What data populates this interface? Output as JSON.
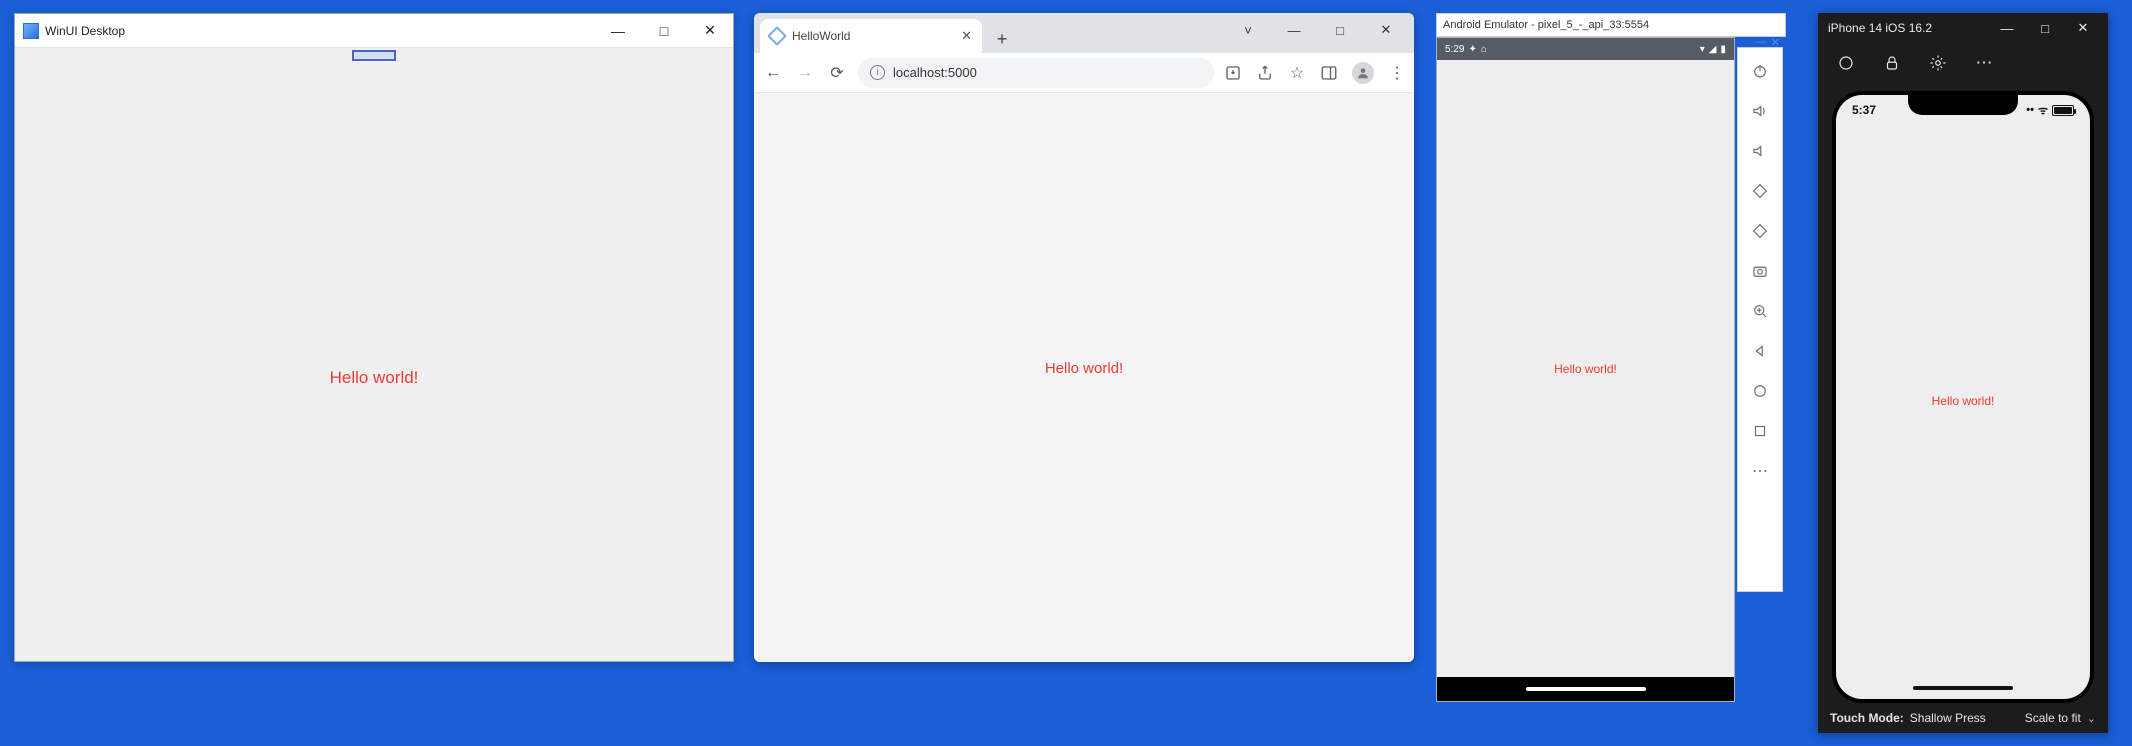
{
  "winui": {
    "title": "WinUI Desktop",
    "hello": "Hello world!"
  },
  "browser": {
    "tab_label": "HelloWorld",
    "url_display": "localhost:5000",
    "hello": "Hello world!",
    "window_ctrls": {
      "caret": "˅",
      "min": "—",
      "max": "□",
      "close": "✕"
    }
  },
  "android": {
    "title": "Android Emulator - pixel_5_-_api_33:5554",
    "status_time": "5:29",
    "hello": "Hello world!"
  },
  "ios": {
    "title": "iPhone 14 iOS 16.2",
    "status_time": "5:37",
    "hello": "Hello world!",
    "footer_label": "Touch Mode:",
    "footer_mode": "Shallow Press",
    "footer_scale": "Scale to fit"
  }
}
